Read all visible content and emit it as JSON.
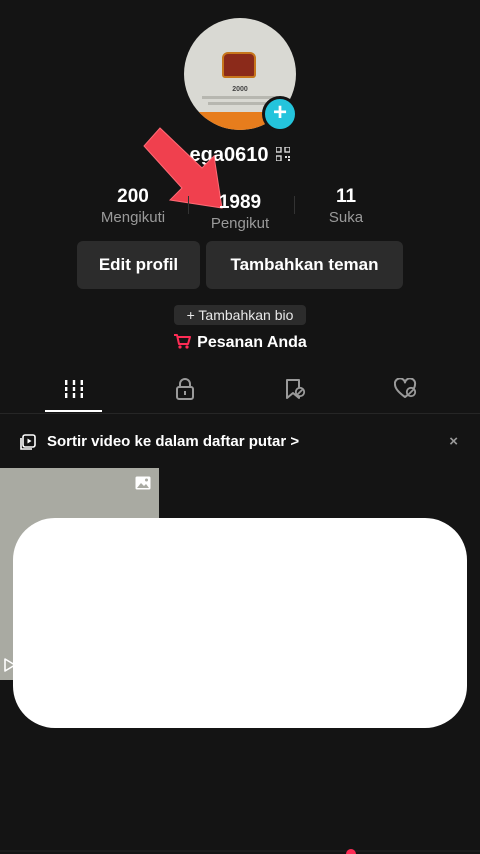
{
  "profile": {
    "username": "ega0610",
    "avatar_text": "2000",
    "avatar_add_icon": "plus-icon"
  },
  "stats": {
    "following": {
      "value": "200",
      "label": "Mengikuti"
    },
    "followers": {
      "value": "1989",
      "label": "Pengikut"
    },
    "likes": {
      "value": "11",
      "label": "Suka"
    }
  },
  "actions": {
    "edit_label": "Edit profil",
    "add_friends_label": "Tambahkan teman",
    "add_bio_label": "+ Tambahkan bio",
    "orders_label": "Pesanan Anda"
  },
  "tabs": [
    {
      "icon": "grid-icon"
    },
    {
      "icon": "lock-icon"
    },
    {
      "icon": "bookmark-icon"
    },
    {
      "icon": "heart-icon"
    }
  ],
  "playlist": {
    "label": "Sortir video ke dalam daftar putar",
    "chevron": ">",
    "close": "×"
  },
  "colors": {
    "background": "#141414",
    "button": "#2c2c2c",
    "accent_cyan": "#24c4dc",
    "accent_red": "#fe2c55",
    "arrow": "#f0404e"
  }
}
